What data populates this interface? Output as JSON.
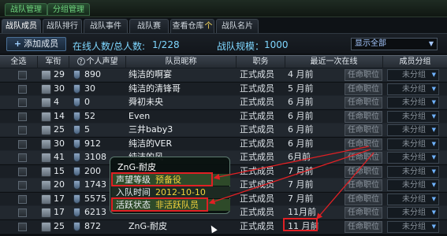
{
  "top_tabs": [
    "战队管理",
    "分组管理"
  ],
  "sub_tabs": [
    "战队成员",
    "战队排行",
    "战队事件",
    "战队赛",
    "查看仓库",
    "战队名片"
  ],
  "sub_tab_warehouse_badge": "个",
  "toolbar": {
    "add_button": "添加成员",
    "online_label": "在线人数/总人数:",
    "online_value": "1/228",
    "scale_label": "战队规模：",
    "scale_value": "1000",
    "filter_value": "显示全部"
  },
  "columns": [
    "全选",
    "军衔",
    "个人声望",
    "队员昵称",
    "职务",
    "最近一次在线",
    "成员分组"
  ],
  "rows": [
    {
      "rank": "29",
      "rep": "890",
      "name": "纯洁的啊宴",
      "role": "正式成员",
      "last_online": "4 月前"
    },
    {
      "rank": "30",
      "rep": "30",
      "name": "纯洁的清锋哥",
      "role": "正式成员",
      "last_online": "5 月前"
    },
    {
      "rank": "4",
      "rep": "0",
      "name": "舜初未央",
      "role": "正式成员",
      "last_online": "6 月前"
    },
    {
      "rank": "14",
      "rep": "52",
      "name": "Even",
      "role": "正式成员",
      "last_online": "6 月前"
    },
    {
      "rank": "25",
      "rep": "5",
      "name": "三井baby3",
      "role": "正式成员",
      "last_online": "6 月前"
    },
    {
      "rank": "30",
      "rep": "912",
      "name": "纯洁的VER",
      "role": "正式成员",
      "last_online": "6 月前"
    },
    {
      "rank": "41",
      "rep": "3108",
      "name": "纯洁的风",
      "role": "正式成员",
      "last_online": "6月前"
    },
    {
      "rank": "15",
      "rep": "200",
      "name": "",
      "role": "正式成员",
      "last_online": "7 月前"
    },
    {
      "rank": "20",
      "rep": "1743",
      "name": "",
      "role": "正式成员",
      "last_online": "7 月前"
    },
    {
      "rank": "17",
      "rep": "5575",
      "name": "",
      "role": "正式成员",
      "last_online": "7 月前"
    },
    {
      "rank": "17",
      "rep": "6213",
      "name": "",
      "role": "正式成员",
      "last_online": "11月前"
    },
    {
      "rank": "25",
      "rep": "872",
      "name": "ZnG-耐皮",
      "role": "正式成员",
      "last_online": "11 月前"
    }
  ],
  "appoint_label": "任命职位",
  "group_label": "未分组",
  "tooltip": {
    "name": "ZnG-耐皮",
    "rep_label": "声望等级",
    "rep_value": "预备役",
    "join_label": "入队时间",
    "join_value": "2012-10-10",
    "active_label": "活跃状态",
    "active_value": "非活跃队员"
  },
  "colors": {
    "highlight": "#e02024",
    "accent": "#7fd7ff",
    "tooltip_value": "#f2d23c"
  },
  "icons": [
    "plus-icon",
    "help-icon",
    "rank-badge-icon",
    "shield-icon",
    "dropdown-arrow-icon",
    "mouse-cursor-icon"
  ]
}
